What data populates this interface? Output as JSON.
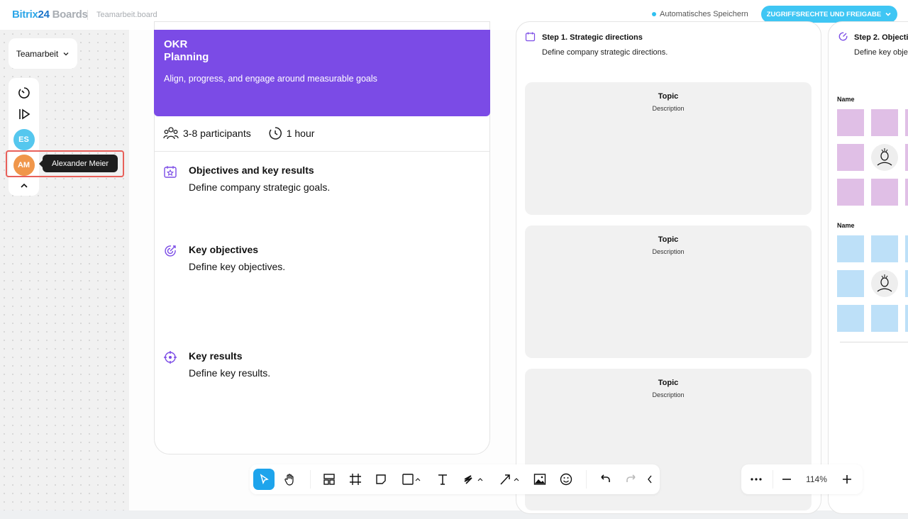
{
  "header": {
    "logo_brand": "Bitrix",
    "logo_num": "24",
    "logo_product": "Boards",
    "file_name": "Teamarbeit.board",
    "autosave": "Automatisches Speichern",
    "share_button": "ZUGRIFFSRECHTE UND FREIGABE"
  },
  "sidebar": {
    "workspace": "Teamarbeit",
    "users": [
      {
        "initials": "ES",
        "color": "#55c7ee"
      },
      {
        "initials": "AM",
        "color": "#f0964a"
      }
    ],
    "tooltip": "Alexander Meier"
  },
  "card": {
    "title_line1": "OKR",
    "title_line2": "Planning",
    "subtitle": "Align, progress, and engage around measurable goals",
    "participants": "3-8 participants",
    "duration": "1 hour",
    "sections": [
      {
        "title": "Objectives and key results",
        "desc": "Define company strategic goals."
      },
      {
        "title": "Key objectives",
        "desc": "Define key objectives."
      },
      {
        "title": "Key results",
        "desc": "Define key results."
      }
    ]
  },
  "step1": {
    "title": "Step 1. Strategic directions",
    "desc": "Define company strategic directions.",
    "topics": [
      {
        "title": "Topic",
        "desc": "Description"
      },
      {
        "title": "Topic",
        "desc": "Description"
      },
      {
        "title": "Topic",
        "desc": "Description"
      }
    ]
  },
  "step2": {
    "title": "Step 2. Objecti",
    "desc": "Define key obje",
    "groups": [
      {
        "label": "Name",
        "color": "#e0bfe6"
      },
      {
        "label": "Name",
        "color": "#bde0f8"
      }
    ]
  },
  "zoom": {
    "level": "114%"
  },
  "colors": {
    "accent": "#7b4be6",
    "primary": "#3fc6f4",
    "select": "#1ea4ec"
  }
}
